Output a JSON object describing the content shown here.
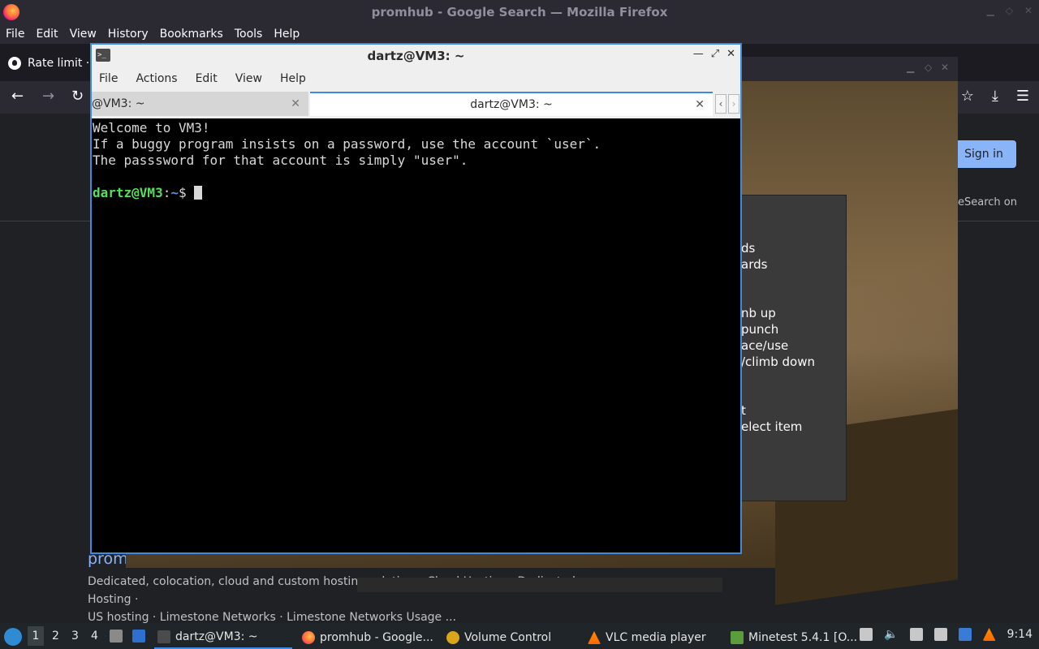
{
  "firefox": {
    "window_title": "promhub - Google Search — Mozilla Firefox",
    "menu": [
      "File",
      "Edit",
      "View",
      "History",
      "Bookmarks",
      "Tools",
      "Help"
    ],
    "tab_title": "Rate limit · (",
    "nav": {
      "back_icon": "arrow-left-icon",
      "forward_icon": "arrow-right-icon",
      "reload_icon": "reload-icon"
    },
    "toolbar_icons": [
      "bookmark-star-icon",
      "download-icon",
      "hamburger-menu-icon"
    ],
    "google": {
      "sign_in": "Sign in",
      "esearch_text": "eSearch on",
      "result_title": "prom",
      "result_desc_1": "Dedicated, colocation, cloud and custom hosting solutions. Cloud Hosting · Dedicated Hosting ·",
      "result_desc_2": "US hosting · Limestone Networks · Limestone Networks Usage ..."
    }
  },
  "minetest": {
    "help_lines": [
      "ds",
      "ards",
      "nb up",
      "punch",
      "ace/use",
      "/climb down",
      "t",
      "elect item"
    ]
  },
  "terminal": {
    "window_title": "dartz@VM3: ~",
    "menu": [
      "File",
      "Actions",
      "Edit",
      "View",
      "Help"
    ],
    "tabs": [
      {
        "label": "@VM3: ~",
        "active": false
      },
      {
        "label": "dartz@VM3: ~",
        "active": true
      }
    ],
    "output_lines": [
      "Welcome to VM3!",
      "If a buggy program insists on a password, use the account `user`.",
      "The passsword for that account is simply \"user\"."
    ],
    "prompt_user": "dartz@VM3",
    "prompt_sep": ":",
    "prompt_path": "~",
    "prompt_symbol": "$ "
  },
  "taskbar": {
    "workspaces": [
      "1",
      "2",
      "3",
      "4"
    ],
    "apps": [
      {
        "label": "dartz@VM3: ~",
        "icon": "terminal-icon"
      },
      {
        "label": "promhub - Google...",
        "icon": "firefox-icon"
      },
      {
        "label": "Volume Control",
        "icon": "volume-control-icon"
      },
      {
        "label": "VLC media player",
        "icon": "vlc-icon"
      },
      {
        "label": "Minetest 5.4.1 [O...",
        "icon": "minetest-icon"
      }
    ],
    "clock": "9:14"
  }
}
